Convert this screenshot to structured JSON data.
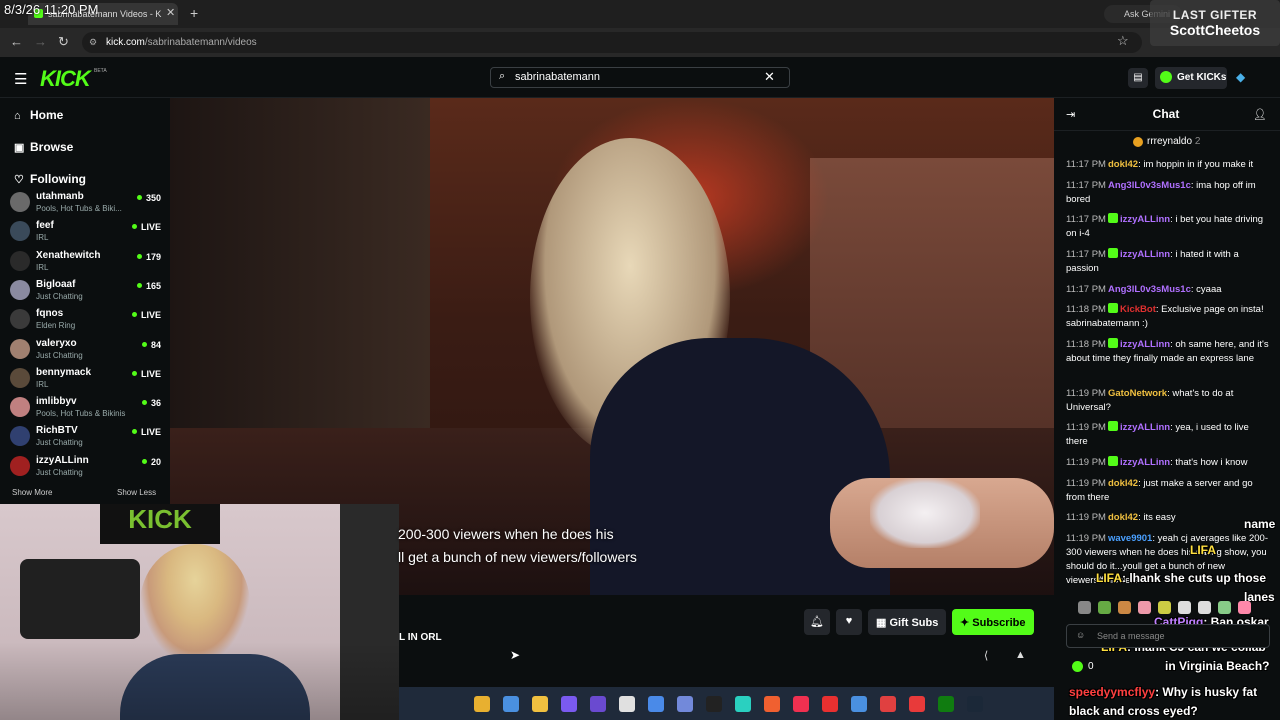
{
  "overlay": {
    "clock": "8/3/26 11:20 PM",
    "last_gifter_title": "LAST GIFTER",
    "last_gifter_name": "ScottCheetos"
  },
  "browser": {
    "tab_title": "sabrinabatemann Videos - K",
    "tab_close": "✕",
    "new_tab": "+",
    "ask_gemini": "Ask Gemini",
    "url_host": "kick.com",
    "url_path": "/sabrinabatemann/videos"
  },
  "header": {
    "logo": "KICK",
    "logo_beta": "BETA",
    "search_value": "sabrinabatemann",
    "get_kicks": "Get KICKs"
  },
  "sidebar": {
    "nav": [
      {
        "icon": "home-icon",
        "label": "Home"
      },
      {
        "icon": "browse-icon",
        "label": "Browse"
      },
      {
        "icon": "heart-icon",
        "label": "Following"
      }
    ],
    "channels": [
      {
        "name": "utahmanb",
        "category": "Pools, Hot Tubs & Biki...",
        "status": "350",
        "live": false,
        "color": "#6a6a6a"
      },
      {
        "name": "feef",
        "category": "IRL",
        "status": "LIVE",
        "live": true,
        "color": "#3a4a5a"
      },
      {
        "name": "Xenathewitch",
        "category": "IRL",
        "status": "179",
        "live": false,
        "color": "#2a2a2a"
      },
      {
        "name": "Bigloaaf",
        "category": "Just Chatting",
        "status": "165",
        "live": false,
        "color": "#8a8aa0"
      },
      {
        "name": "fqnos",
        "category": "Elden Ring",
        "status": "LIVE",
        "live": true,
        "color": "#3a3a3a"
      },
      {
        "name": "valeryxo",
        "category": "Just Chatting",
        "status": "84",
        "live": false,
        "color": "#a08070"
      },
      {
        "name": "bennymack",
        "category": "IRL",
        "status": "LIVE",
        "live": true,
        "color": "#5a4a3a"
      },
      {
        "name": "imlibbyv",
        "category": "Pools, Hot Tubs & Bikinis",
        "status": "36",
        "live": false,
        "color": "#c08080"
      },
      {
        "name": "RichBTV",
        "category": "Just Chatting",
        "status": "LIVE",
        "live": true,
        "color": "#304070"
      },
      {
        "name": "izzyALLinn",
        "category": "Just Chatting",
        "status": "20",
        "live": false,
        "color": "#a02020"
      }
    ],
    "show_more": "Show More",
    "show_less": "Show Less"
  },
  "video": {
    "caption_line1": "200-300 viewers when he does his",
    "caption_line2": "ll get a bunch of new viewers/followers"
  },
  "below_video": {
    "title_fragment": "L IN ORL",
    "gift_subs": "Gift Subs",
    "subscribe": "Subscribe"
  },
  "chat": {
    "title": "Chat",
    "pinned_user": "rrreynaldo",
    "pinned_count": "2",
    "messages": [
      {
        "time": "11:17 PM",
        "user": "dokl42",
        "color": "#f0c040",
        "badge": false,
        "text": "im hoppin in if you make it"
      },
      {
        "time": "11:17 PM",
        "user": "Ang3lL0v3sMus1c",
        "color": "#b070ff",
        "badge": false,
        "text": "ima hop off im bored"
      },
      {
        "time": "11:17 PM",
        "user": "izzyALLinn",
        "color": "#b070ff",
        "badge": true,
        "text": "i bet you hate driving on i-4"
      },
      {
        "time": "11:17 PM",
        "user": "izzyALLinn",
        "color": "#b070ff",
        "badge": true,
        "text": "i hated it with a passion"
      },
      {
        "time": "11:17 PM",
        "user": "Ang3lL0v3sMus1c",
        "color": "#b070ff",
        "badge": false,
        "text": "cyaaa"
      },
      {
        "time": "11:18 PM",
        "user": "KickBot",
        "color": "#e03030",
        "badge": true,
        "text": "Exclusive page on insta! sabrinabatemann :)"
      },
      {
        "time": "11:18 PM",
        "user": "izzyALLinn",
        "color": "#b070ff",
        "badge": true,
        "text": "oh same here, and it's about time they finally made an express lane"
      },
      {
        "time": "11:19 PM",
        "user": "GatoNetwork",
        "color": "#f0c040",
        "badge": false,
        "text": "what's to do at Universal?"
      },
      {
        "time": "11:19 PM",
        "user": "izzyALLinn",
        "color": "#b070ff",
        "badge": true,
        "text": "yea, i used to live there"
      },
      {
        "time": "11:19 PM",
        "user": "izzyALLinn",
        "color": "#b070ff",
        "badge": true,
        "text": "that's how i know"
      },
      {
        "time": "11:19 PM",
        "user": "dokl42",
        "color": "#f0c040",
        "badge": false,
        "text": "just make a server and go from there"
      },
      {
        "time": "11:19 PM",
        "user": "dokl42",
        "color": "#f0c040",
        "badge": false,
        "text": "its easy"
      },
      {
        "time": "11:19 PM",
        "user": "wave9901",
        "color": "#4aa0ff",
        "badge": false,
        "text": "yeah cj averages like 200-300 viewers when he does his dating show, you should do it...youll get a bunch of new viewers/followers"
      }
    ],
    "input_placeholder": "Send a message",
    "kicks_count": "0"
  },
  "stream_chat_overlay": [
    {
      "user": "",
      "text": "name",
      "user_color": "#ffffff"
    },
    {
      "user": "LIFA",
      "text": "",
      "user_color": "#ffe040"
    },
    {
      "user": "LIFA",
      "text": ": lhank she cuts up those",
      "user_color": "#ffe040"
    },
    {
      "user": "",
      "text": "lanes",
      "user_color": "#ffffff"
    },
    {
      "user": "CattPigg",
      "text": ": Ban oskar",
      "user_color": "#c080ff"
    },
    {
      "user": "LIFA",
      "text": ": lhank CJ can we collab",
      "user_color": "#ffe040"
    },
    {
      "user": "",
      "text": "in Virginia Beach?",
      "user_color": "#ffffff"
    },
    {
      "user": "speedyymcflyy",
      "text": ": Why is husky fat",
      "user_color": "#ff4040"
    },
    {
      "user": "",
      "text": "black and cross eyed?",
      "user_color": "#ffffff"
    }
  ]
}
